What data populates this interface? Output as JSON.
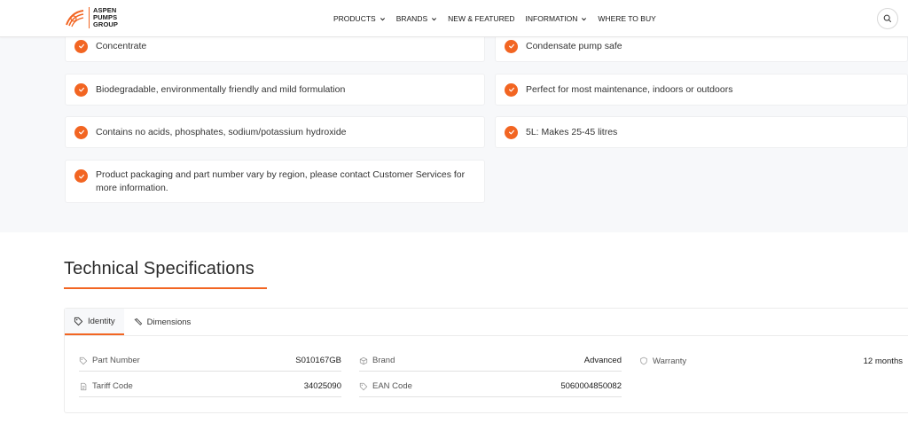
{
  "header": {
    "logo_lines": [
      "ASPEN",
      "PUMPS",
      "GROUP"
    ],
    "nav": [
      {
        "label": "PRODUCTS",
        "dropdown": true
      },
      {
        "label": "BRANDS",
        "dropdown": true
      },
      {
        "label": "NEW & FEATURED",
        "dropdown": false
      },
      {
        "label": "INFORMATION",
        "dropdown": true
      },
      {
        "label": "WHERE TO BUY",
        "dropdown": false
      }
    ],
    "search_icon": "search-icon"
  },
  "features": [
    "Concentrate",
    "Condensate pump safe",
    "Biodegradable, environmentally friendly and mild formulation",
    "Perfect for most maintenance, indoors or outdoors",
    "Contains no acids, phosphates, sodium/potassium hydroxide",
    "5L: Makes 25-45 litres",
    "Product packaging and part number vary by region, please contact Customer Services for more information."
  ],
  "tech": {
    "title": "Technical Specifications",
    "tabs": [
      {
        "label": "Identity",
        "icon": "tag-icon",
        "active": true
      },
      {
        "label": "Dimensions",
        "icon": "ruler-icon",
        "active": false
      }
    ],
    "specs": [
      {
        "label": "Part Number",
        "value": "S010167GB",
        "icon": "tag-icon"
      },
      {
        "label": "Brand",
        "value": "Advanced",
        "icon": "box-icon"
      },
      {
        "label": "Warranty",
        "value": "12 months",
        "icon": "shield-icon"
      },
      {
        "label": "Tariff Code",
        "value": "34025090",
        "icon": "document-icon"
      },
      {
        "label": "EAN Code",
        "value": "5060004850082",
        "icon": "tag-icon"
      }
    ]
  },
  "colors": {
    "accent": "#f26522",
    "section_bg": "#f7f8fa"
  }
}
